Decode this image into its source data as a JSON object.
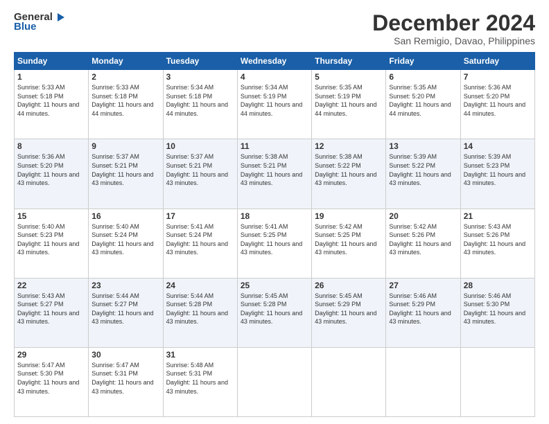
{
  "logo": {
    "line1": "General",
    "line2": "Blue"
  },
  "title": "December 2024",
  "location": "San Remigio, Davao, Philippines",
  "days_of_week": [
    "Sunday",
    "Monday",
    "Tuesday",
    "Wednesday",
    "Thursday",
    "Friday",
    "Saturday"
  ],
  "weeks": [
    [
      {
        "num": "1",
        "sunrise": "5:33 AM",
        "sunset": "5:18 PM",
        "daylight": "11 hours and 44 minutes."
      },
      {
        "num": "2",
        "sunrise": "5:33 AM",
        "sunset": "5:18 PM",
        "daylight": "11 hours and 44 minutes."
      },
      {
        "num": "3",
        "sunrise": "5:34 AM",
        "sunset": "5:18 PM",
        "daylight": "11 hours and 44 minutes."
      },
      {
        "num": "4",
        "sunrise": "5:34 AM",
        "sunset": "5:19 PM",
        "daylight": "11 hours and 44 minutes."
      },
      {
        "num": "5",
        "sunrise": "5:35 AM",
        "sunset": "5:19 PM",
        "daylight": "11 hours and 44 minutes."
      },
      {
        "num": "6",
        "sunrise": "5:35 AM",
        "sunset": "5:20 PM",
        "daylight": "11 hours and 44 minutes."
      },
      {
        "num": "7",
        "sunrise": "5:36 AM",
        "sunset": "5:20 PM",
        "daylight": "11 hours and 44 minutes."
      }
    ],
    [
      {
        "num": "8",
        "sunrise": "5:36 AM",
        "sunset": "5:20 PM",
        "daylight": "11 hours and 43 minutes."
      },
      {
        "num": "9",
        "sunrise": "5:37 AM",
        "sunset": "5:21 PM",
        "daylight": "11 hours and 43 minutes."
      },
      {
        "num": "10",
        "sunrise": "5:37 AM",
        "sunset": "5:21 PM",
        "daylight": "11 hours and 43 minutes."
      },
      {
        "num": "11",
        "sunrise": "5:38 AM",
        "sunset": "5:21 PM",
        "daylight": "11 hours and 43 minutes."
      },
      {
        "num": "12",
        "sunrise": "5:38 AM",
        "sunset": "5:22 PM",
        "daylight": "11 hours and 43 minutes."
      },
      {
        "num": "13",
        "sunrise": "5:39 AM",
        "sunset": "5:22 PM",
        "daylight": "11 hours and 43 minutes."
      },
      {
        "num": "14",
        "sunrise": "5:39 AM",
        "sunset": "5:23 PM",
        "daylight": "11 hours and 43 minutes."
      }
    ],
    [
      {
        "num": "15",
        "sunrise": "5:40 AM",
        "sunset": "5:23 PM",
        "daylight": "11 hours and 43 minutes."
      },
      {
        "num": "16",
        "sunrise": "5:40 AM",
        "sunset": "5:24 PM",
        "daylight": "11 hours and 43 minutes."
      },
      {
        "num": "17",
        "sunrise": "5:41 AM",
        "sunset": "5:24 PM",
        "daylight": "11 hours and 43 minutes."
      },
      {
        "num": "18",
        "sunrise": "5:41 AM",
        "sunset": "5:25 PM",
        "daylight": "11 hours and 43 minutes."
      },
      {
        "num": "19",
        "sunrise": "5:42 AM",
        "sunset": "5:25 PM",
        "daylight": "11 hours and 43 minutes."
      },
      {
        "num": "20",
        "sunrise": "5:42 AM",
        "sunset": "5:26 PM",
        "daylight": "11 hours and 43 minutes."
      },
      {
        "num": "21",
        "sunrise": "5:43 AM",
        "sunset": "5:26 PM",
        "daylight": "11 hours and 43 minutes."
      }
    ],
    [
      {
        "num": "22",
        "sunrise": "5:43 AM",
        "sunset": "5:27 PM",
        "daylight": "11 hours and 43 minutes."
      },
      {
        "num": "23",
        "sunrise": "5:44 AM",
        "sunset": "5:27 PM",
        "daylight": "11 hours and 43 minutes."
      },
      {
        "num": "24",
        "sunrise": "5:44 AM",
        "sunset": "5:28 PM",
        "daylight": "11 hours and 43 minutes."
      },
      {
        "num": "25",
        "sunrise": "5:45 AM",
        "sunset": "5:28 PM",
        "daylight": "11 hours and 43 minutes."
      },
      {
        "num": "26",
        "sunrise": "5:45 AM",
        "sunset": "5:29 PM",
        "daylight": "11 hours and 43 minutes."
      },
      {
        "num": "27",
        "sunrise": "5:46 AM",
        "sunset": "5:29 PM",
        "daylight": "11 hours and 43 minutes."
      },
      {
        "num": "28",
        "sunrise": "5:46 AM",
        "sunset": "5:30 PM",
        "daylight": "11 hours and 43 minutes."
      }
    ],
    [
      {
        "num": "29",
        "sunrise": "5:47 AM",
        "sunset": "5:30 PM",
        "daylight": "11 hours and 43 minutes."
      },
      {
        "num": "30",
        "sunrise": "5:47 AM",
        "sunset": "5:31 PM",
        "daylight": "11 hours and 43 minutes."
      },
      {
        "num": "31",
        "sunrise": "5:48 AM",
        "sunset": "5:31 PM",
        "daylight": "11 hours and 43 minutes."
      },
      null,
      null,
      null,
      null
    ]
  ],
  "labels": {
    "sunrise": "Sunrise:",
    "sunset": "Sunset:",
    "daylight": "Daylight:"
  }
}
